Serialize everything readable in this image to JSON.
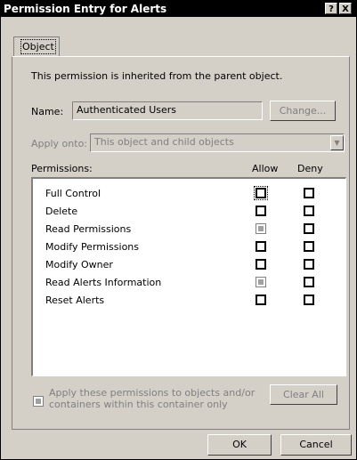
{
  "window": {
    "title": "Permission Entry for Alerts",
    "help_label": "?",
    "close_label": "X"
  },
  "tabs": [
    {
      "label": "Object"
    }
  ],
  "inherited_note": "This permission is inherited from the parent object.",
  "name": {
    "label": "Name:",
    "value": "Authenticated Users",
    "change_label": "Change..."
  },
  "apply_onto": {
    "label": "Apply onto:",
    "value": "This object and child objects"
  },
  "permissions": {
    "label": "Permissions:",
    "col_allow": "Allow",
    "col_deny": "Deny",
    "rows": [
      {
        "name": "Full Control",
        "allow": false,
        "deny": false
      },
      {
        "name": "Delete",
        "allow": false,
        "deny": false
      },
      {
        "name": "Read Permissions",
        "allow": true,
        "deny": false
      },
      {
        "name": "Modify Permissions",
        "allow": false,
        "deny": false
      },
      {
        "name": "Modify Owner",
        "allow": false,
        "deny": false
      },
      {
        "name": "Read Alerts Information",
        "allow": true,
        "deny": false
      },
      {
        "name": "Reset Alerts",
        "allow": false,
        "deny": false
      }
    ]
  },
  "apply_container": {
    "line1": "Apply these permissions to objects and/or",
    "line2": "containers within this container only"
  },
  "clear_all_label": "Clear All",
  "ok_label": "OK",
  "cancel_label": "Cancel"
}
